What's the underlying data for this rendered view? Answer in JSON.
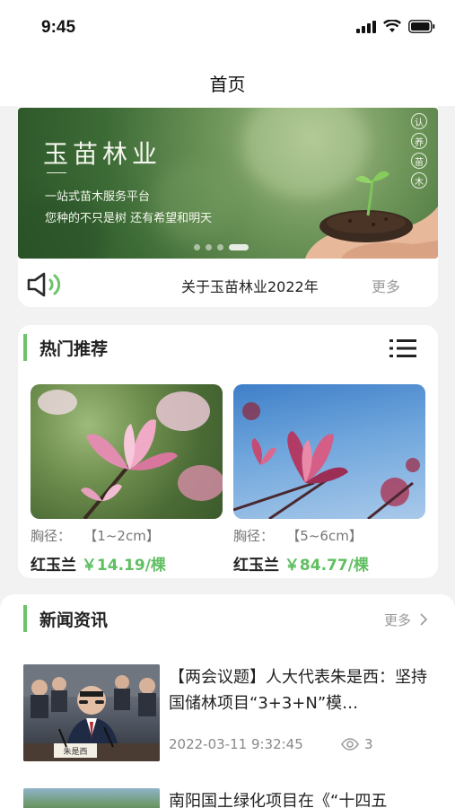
{
  "status": {
    "time": "9:45"
  },
  "nav": {
    "title": "首页"
  },
  "banner": {
    "title": "玉苗林业",
    "subtitle1": "一站式苗木服务平台",
    "subtitle2": "您种的不只是树 还有希望和明天",
    "vertical_chars": [
      "认",
      "养",
      "苗",
      "木"
    ],
    "active_slide": 4,
    "slide_count": 4
  },
  "notice": {
    "text": "关于玉苗林业2022年",
    "more": "更多"
  },
  "hot": {
    "title": "热门推荐",
    "items": [
      {
        "spec": "胸径：   【1~2cm】",
        "name": "红玉兰",
        "price": "￥14.19/棵"
      },
      {
        "spec": "胸径：   【5~6cm】",
        "name": "红玉兰",
        "price": "￥84.77/棵"
      }
    ]
  },
  "news": {
    "title": "新闻资讯",
    "more": "更多",
    "items": [
      {
        "headline": "【两会议题】人大代表朱是西：坚持国储林项目“3+3+N”模…",
        "date": "2022-03-11 9:32:45",
        "views": "3",
        "nameplate": "朱是西"
      },
      {
        "headline": "南阳国土绿化项目在《“十四五"
      }
    ]
  },
  "colors": {
    "accent": "#6dc36b",
    "price": "#5fbf61",
    "muted": "#999999"
  }
}
